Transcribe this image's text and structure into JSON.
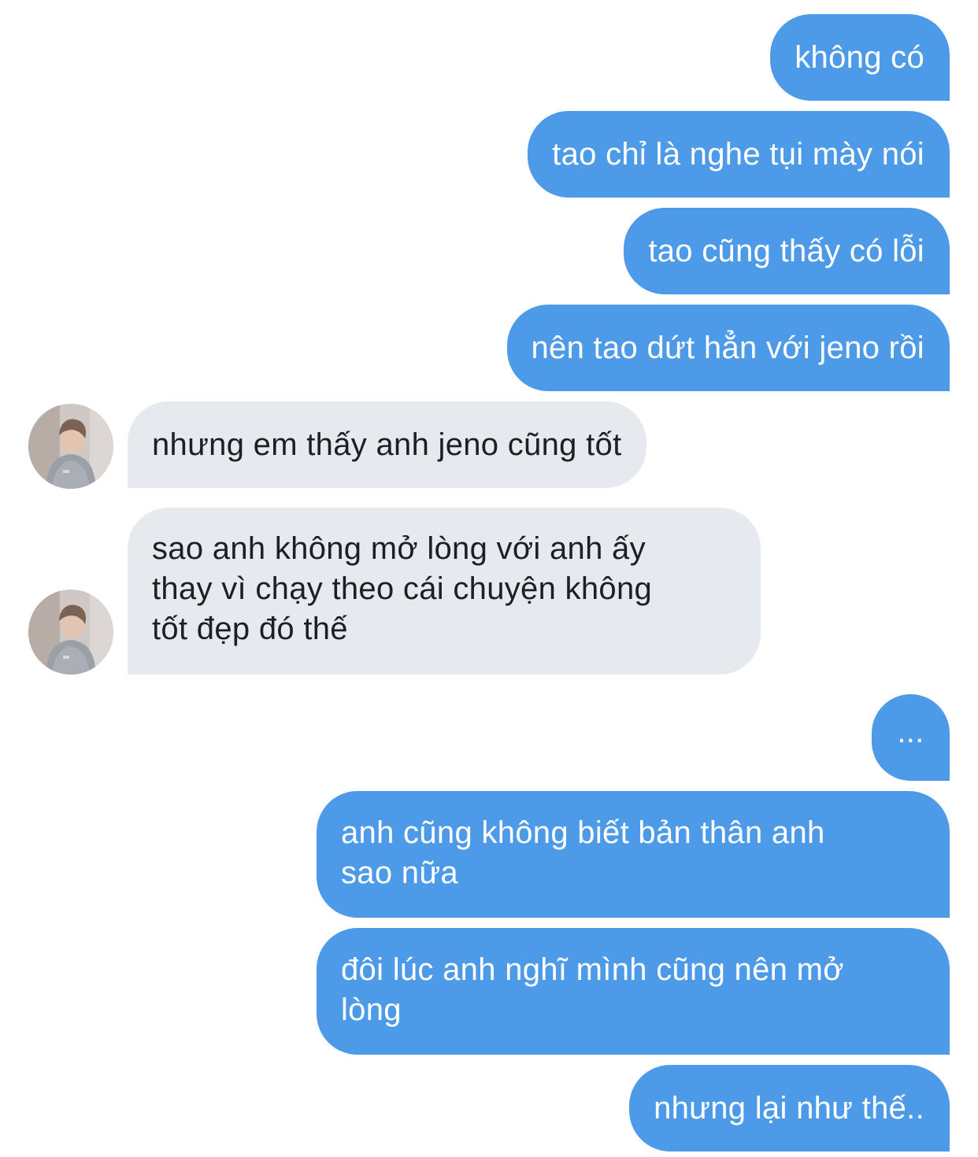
{
  "conversation": {
    "messages": [
      {
        "direction": "sent",
        "text": "không có"
      },
      {
        "direction": "sent",
        "text": "tao chỉ là nghe tụi mày nói"
      },
      {
        "direction": "sent",
        "text": "tao cũng thấy có lỗi"
      },
      {
        "direction": "sent",
        "text": "nên tao dứt hẳn với jeno rồi"
      },
      {
        "direction": "received",
        "text": "nhưng em thấy anh jeno cũng tốt"
      },
      {
        "direction": "received",
        "lines": [
          "sao anh không mở lòng với anh ấy",
          "thay vì chạy theo cái chuyện không",
          "tốt đẹp đó thế"
        ]
      },
      {
        "direction": "sent",
        "text": "..."
      },
      {
        "direction": "sent",
        "lines": [
          "anh cũng không biết bản thân anh",
          "sao nữa"
        ]
      },
      {
        "direction": "sent",
        "lines": [
          "đôi lúc anh nghĩ mình cũng nên mở",
          "lòng"
        ]
      },
      {
        "direction": "sent",
        "text": "nhưng lại như thế.."
      }
    ]
  },
  "colors": {
    "sent_bubble": "#4d9be8",
    "received_bubble": "#e6e9ed",
    "sent_text": "#ffffff",
    "received_text": "#1c1f23"
  },
  "icons": {
    "avatar": "contact-photo"
  }
}
